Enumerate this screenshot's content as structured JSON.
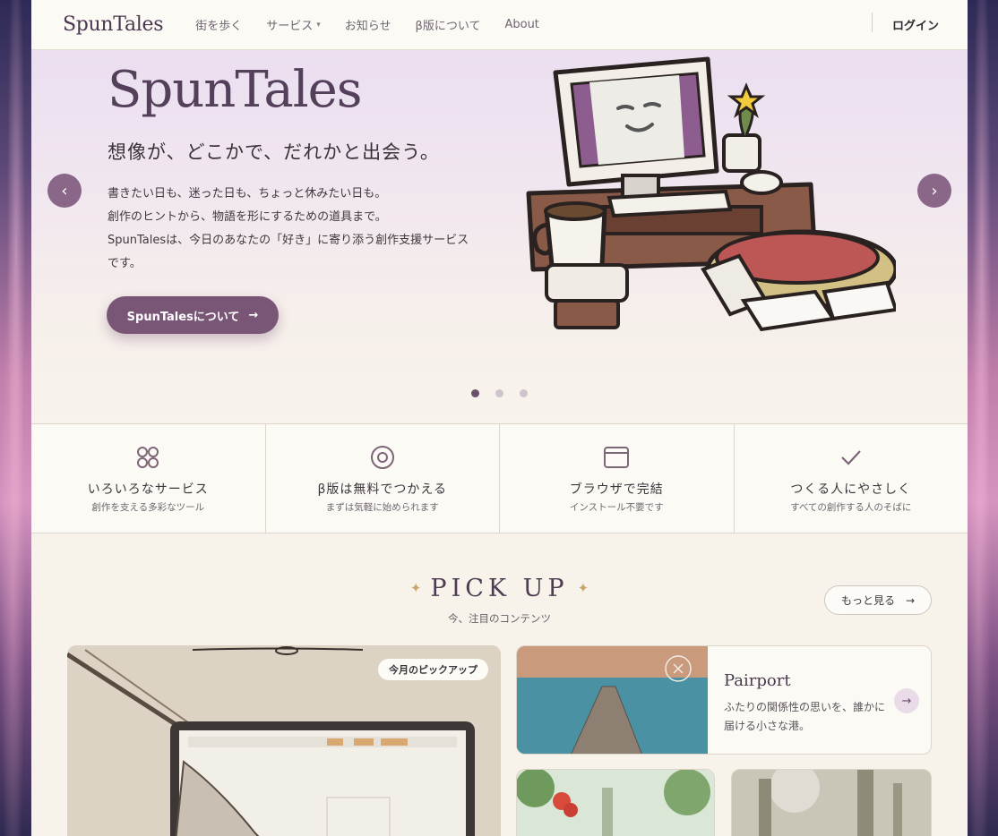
{
  "brand": {
    "logo": "SpunTales"
  },
  "nav": {
    "items": [
      {
        "label": "街を歩く"
      },
      {
        "label": "サービス"
      },
      {
        "label": "お知らせ"
      },
      {
        "label": "β版について"
      },
      {
        "label": "About"
      }
    ],
    "login": "ログイン"
  },
  "hero": {
    "title": "SpunTales",
    "subtitle": "想像が、どこかで、だれかと出会う。",
    "body_lines": [
      "書きたい日も、迷った日も、ちょっと休みたい日も。",
      "創作のヒントから、物語を形にするための道具まで。",
      "SpunTalesは、今日のあなたの「好き」に寄り添う創作支援サービスです。"
    ],
    "button": "SpunTalesについて",
    "button_arrow": "→",
    "prev_icon": "‹",
    "next_icon": "›",
    "slides_total": 3,
    "slide_active": 1
  },
  "features": [
    {
      "icon": "grid-circles-icon",
      "title": "いろいろなサービス",
      "desc": "創作を支える多彩なツール"
    },
    {
      "icon": "target-icon",
      "title": "β版は無料でつかえる",
      "desc": "まずは気軽に始められます"
    },
    {
      "icon": "browser-window-icon",
      "title": "ブラウザで完結",
      "desc": "インストール不要です"
    },
    {
      "icon": "check-icon",
      "title": "つくる人にやさしく",
      "desc": "すべての創作する人のそばに"
    }
  ],
  "pickup": {
    "title": "PICK UP",
    "spark": "✦",
    "subtitle": "今、注目のコンテンツ",
    "more": "もっと見る",
    "more_arrow": "→",
    "featured_badge": "今月のピックアップ",
    "pairport": {
      "name": "Pairport",
      "desc": "ふたりの関係性の思いを、誰かに届ける小さな港。",
      "arrow": "→"
    }
  },
  "colors": {
    "accent": "#7a5676",
    "gold": "#c9a56c"
  }
}
